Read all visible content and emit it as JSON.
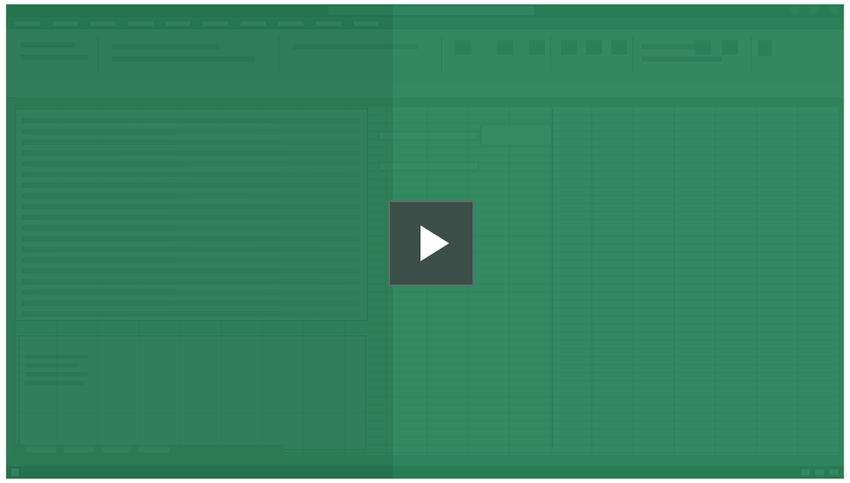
{
  "player": {
    "state": "paused"
  },
  "play_button": {
    "icon": "play-icon"
  },
  "colors": {
    "overlay": "#2f8558",
    "play_bg": "#3c4e48",
    "play_arrow": "#ffffff"
  }
}
